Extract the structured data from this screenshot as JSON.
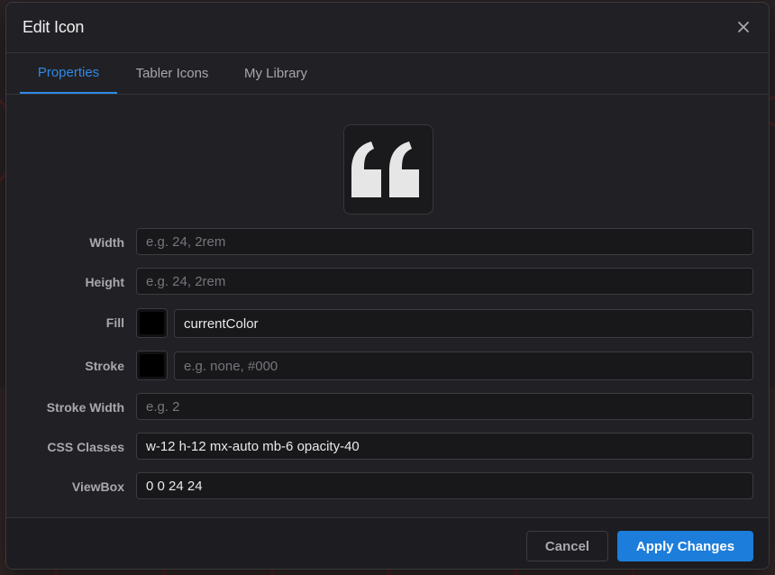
{
  "modal": {
    "title": "Edit Icon",
    "close_icon": "close-icon"
  },
  "tabs": [
    {
      "label": "Properties",
      "active": true
    },
    {
      "label": "Tabler Icons",
      "active": false
    },
    {
      "label": "My Library",
      "active": false
    }
  ],
  "preview": {
    "icon": "quote-icon",
    "color": "#e6e6e6"
  },
  "form": {
    "width": {
      "label": "Width",
      "value": "",
      "placeholder": "e.g. 24, 2rem"
    },
    "height": {
      "label": "Height",
      "value": "",
      "placeholder": "e.g. 24, 2rem"
    },
    "fill": {
      "label": "Fill",
      "value": "currentColor",
      "placeholder": "",
      "swatch_color": "#000000"
    },
    "stroke": {
      "label": "Stroke",
      "value": "",
      "placeholder": "e.g. none, #000",
      "swatch_color": "#000000"
    },
    "stroke_width": {
      "label": "Stroke Width",
      "value": "",
      "placeholder": "e.g. 2"
    },
    "css_classes": {
      "label": "CSS Classes",
      "value": "w-12 h-12 mx-auto mb-6 opacity-40",
      "placeholder": ""
    },
    "viewbox": {
      "label": "ViewBox",
      "value": "0 0 24 24",
      "placeholder": ""
    }
  },
  "footer": {
    "cancel_label": "Cancel",
    "apply_label": "Apply Changes"
  },
  "colors": {
    "accent": "#2d8ae6",
    "primary_button": "#1c7ddb",
    "modal_bg": "#212024"
  }
}
